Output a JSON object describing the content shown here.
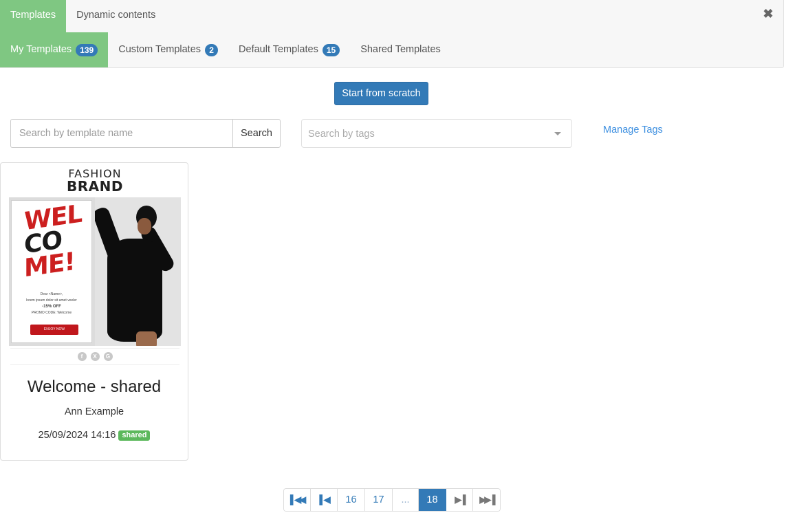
{
  "header": {
    "top_tabs": [
      {
        "label": "Templates",
        "active": true
      },
      {
        "label": "Dynamic contents",
        "active": false
      }
    ],
    "sub_tabs": [
      {
        "label": "My Templates",
        "count": "139",
        "active": true
      },
      {
        "label": "Custom Templates",
        "count": "2",
        "active": false
      },
      {
        "label": "Default Templates",
        "count": "15",
        "active": false
      },
      {
        "label": "Shared Templates",
        "count": null,
        "active": false
      }
    ],
    "close_icon": "close-icon"
  },
  "actions": {
    "start_from_scratch": "Start from scratch"
  },
  "search": {
    "name_placeholder": "Search by template name",
    "name_value": "",
    "search_button": "Search",
    "tags_placeholder": "Search by tags",
    "manage_tags": "Manage Tags"
  },
  "templates": [
    {
      "title": "Welcome - shared",
      "author": "Ann Example",
      "date": "25/09/2024 14:16",
      "badge": "shared",
      "thumbnail": {
        "brand_line1": "FASHION",
        "brand_line2": "BRAND",
        "headline_parts": [
          "WEL",
          "CO",
          "ME!"
        ],
        "greeting": "Dear <Name>,",
        "body": "lorem ipsum dolor sit amet veeler",
        "offer": "-15% OFF",
        "promo": "PROMO CODE: Welcome",
        "cta": "ENJOY NOW",
        "social_icons": [
          "facebook-icon",
          "x-icon",
          "google-plus-icon"
        ]
      }
    }
  ],
  "pagination": {
    "first_icon": "first-page-icon",
    "prev_icon": "prev-page-icon",
    "pages": [
      "16",
      "17",
      "...",
      "18"
    ],
    "current": "18",
    "next_icon": "next-page-icon",
    "last_icon": "last-page-icon"
  },
  "colors": {
    "active_tab": "#7fc782",
    "primary": "#337ab7",
    "shared_badge": "#5cb85c",
    "link": "#3d8fe0"
  }
}
